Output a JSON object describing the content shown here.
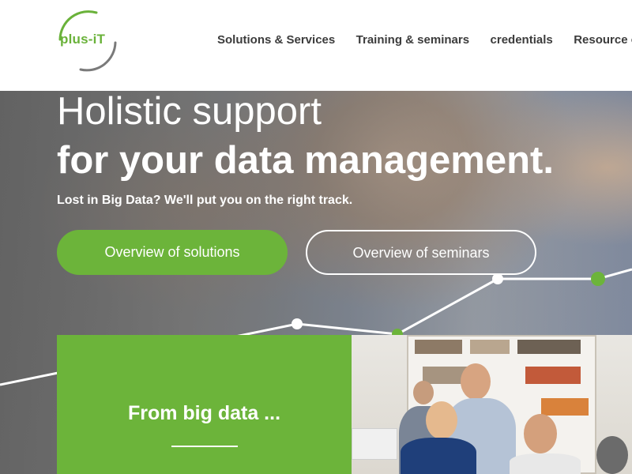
{
  "logo": {
    "text": "plus-iT"
  },
  "nav": {
    "items": [
      "Solutions & Services",
      "Training & seminars",
      "credentials",
      "Resource c"
    ]
  },
  "hero": {
    "title_light": "Holistic support",
    "title_bold": "for your data management.",
    "subtitle": "Lost in Big Data? We'll put you on the right track.",
    "btn_primary": "Overview of solutions",
    "btn_secondary": "Overview of seminars"
  },
  "card": {
    "title": "From big data ..."
  },
  "colors": {
    "brand_green": "#6cb43a",
    "nav_text": "#3c3c3c"
  }
}
